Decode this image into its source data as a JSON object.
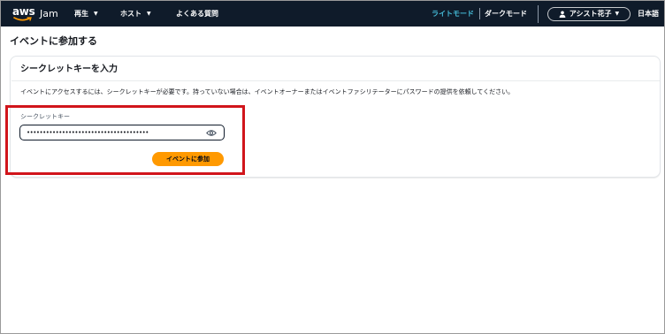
{
  "colors": {
    "nav_bg": "#0f1b2a",
    "accent_link": "#44b9d6",
    "primary_button": "#ff9900",
    "highlight_box": "#d1151b"
  },
  "header": {
    "logo_text": "aws",
    "app_name": "Jam",
    "menus": [
      {
        "label": "再生",
        "icon": "caret-down-icon"
      },
      {
        "label": "ホスト",
        "icon": "caret-down-icon"
      },
      {
        "label": "よくある質問"
      }
    ],
    "theme_light": "ライトモード",
    "theme_dark": "ダークモード",
    "user_name": "アシスト花子",
    "user_icon": "user-icon",
    "language": "日本語"
  },
  "page": {
    "title": "イベントに参加する",
    "card": {
      "title": "シークレットキーを入力",
      "description": "イベントにアクセスするには、シークレットキーが必要です。持っていない場合は、イベントオーナーまたはイベントファシリテーターにパスワードの提供を依頼してください。",
      "field_label": "シークレットキー",
      "field_value": "••••••••••••••••••••••••••••••••••••••",
      "visibility_icon": "eye-icon",
      "submit_label": "イベントに参加"
    }
  }
}
